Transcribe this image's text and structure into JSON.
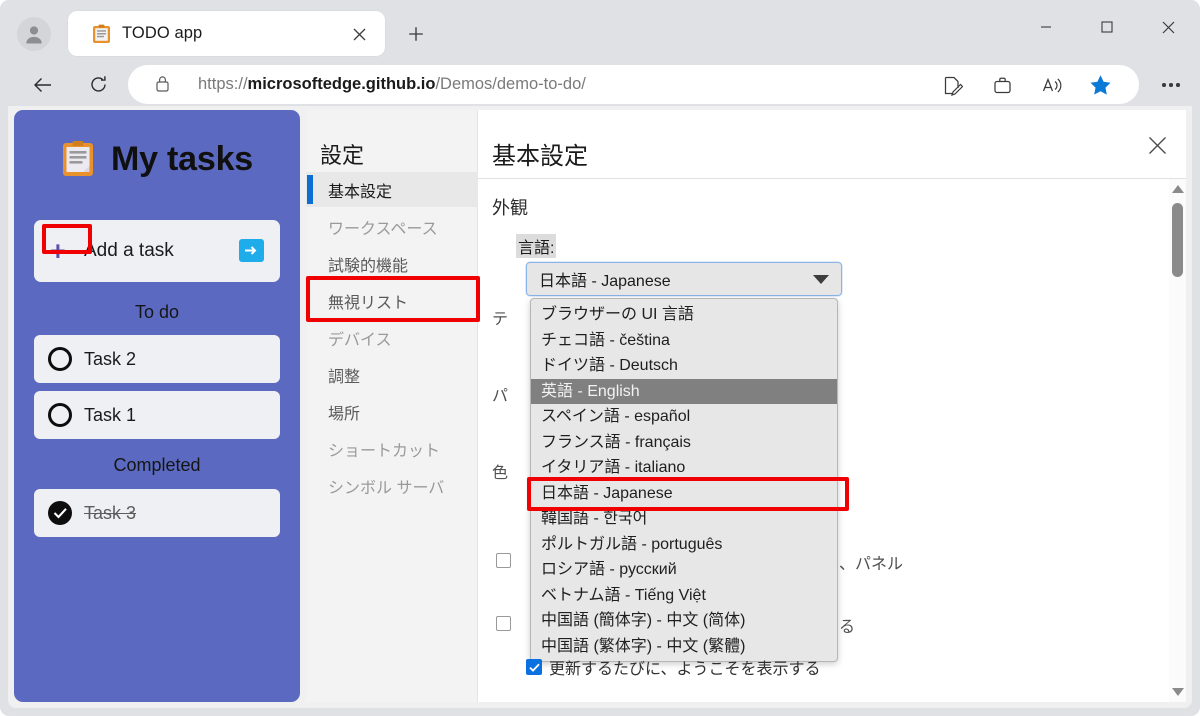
{
  "browser": {
    "tab": {
      "title": "TODO app",
      "favicon": "clipboard-icon",
      "close": "×"
    },
    "new_tab": "+",
    "window_controls": {
      "minimize": "—",
      "maximize": "□",
      "close": "✕"
    },
    "nav": {
      "back": "←",
      "reload": "⟳"
    },
    "url": {
      "scheme": "https://",
      "host": "microsoftedge.github.io",
      "path": "/Demos/demo-to-do/",
      "lock": "lock-icon"
    },
    "omnibox_icons": [
      "collections-icon",
      "briefcase-icon",
      "read-aloud-icon",
      "favorite-star-icon"
    ],
    "more": "…"
  },
  "tasks": {
    "title": "My tasks",
    "add_task_label": "Add a task",
    "add_task_submit": "→",
    "sections": [
      {
        "label": "To do",
        "items": [
          {
            "text": "Task 2",
            "done": false
          },
          {
            "text": "Task 1",
            "done": false
          }
        ]
      },
      {
        "label": "Completed",
        "items": [
          {
            "text": "Task 3",
            "done": true
          }
        ]
      }
    ]
  },
  "settings": {
    "nav_title": "設定",
    "nav_items": [
      {
        "label": "基本設定",
        "active": true
      },
      {
        "label": "ワークスペース",
        "active": false
      },
      {
        "label": "試験的機能",
        "active": false,
        "dark": true
      },
      {
        "label": "無視リスト",
        "active": false,
        "dark": true
      },
      {
        "label": "デバイス",
        "active": false
      },
      {
        "label": "調整",
        "active": false,
        "dark": true
      },
      {
        "label": "場所",
        "active": false,
        "dark": true
      },
      {
        "label": "ショートカット",
        "active": false
      },
      {
        "label": "シンボル サーバ",
        "active": false
      }
    ],
    "title": "基本設定",
    "group_label": "外観",
    "language_field_label": "言語:",
    "language_selected": "日本語 - Japanese",
    "language_options": [
      "ブラウザーの UI 言語",
      "チェコ語 - čeština",
      "ドイツ語 - Deutsch",
      "英語 - English",
      "スペイン語 - español",
      "フランス語 - français",
      "イタリア語 - italiano",
      "日本語 - Japanese",
      "韓国語 - 한국어",
      "ポルトガル語 - português",
      "ロシア語 - русский",
      "ベトナム語 - Tiếng Việt",
      "中国語 (簡体字) - 中文 (简体)",
      "中国語 (繁体字) - 中文 (繁體)"
    ],
    "language_highlighted": "英語 - English",
    "obscured_text": {
      "theme_partial": "テ",
      "panel_partial": "パ",
      "color_partial": "色",
      "panel_tail": "、パネル",
      "row_tail": "る"
    },
    "bottom_checkbox": {
      "checked": true,
      "check_glyph": "✓",
      "label": "更新するたびに、ようこそを表示する"
    },
    "close_label": "✕",
    "scrollbar": {
      "up": "▲",
      "down": "▼"
    }
  },
  "annotations": {
    "highlight_color": "#f00000",
    "accent_blue": "#0b6ed0",
    "panel_purple": "#5b6ac0"
  }
}
